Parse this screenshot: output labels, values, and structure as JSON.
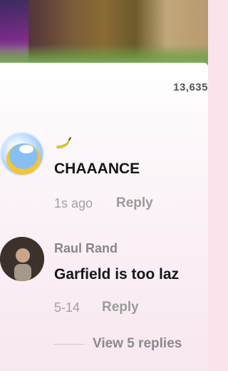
{
  "header": {
    "comment_count": "13,635"
  },
  "comments": [
    {
      "username": "",
      "username_icon": "banana-emoji",
      "text": "CHAAANCE",
      "time": "1s ago",
      "reply_label": "Reply"
    },
    {
      "username": "Raul Rand",
      "text": "Garfield is too laz",
      "time": "5-14",
      "reply_label": "Reply",
      "view_replies": "View 5 replies"
    }
  ],
  "colors": {
    "text_dark": "#161616",
    "meta": "#a2a2a2",
    "reply": "#9b9b9b"
  }
}
